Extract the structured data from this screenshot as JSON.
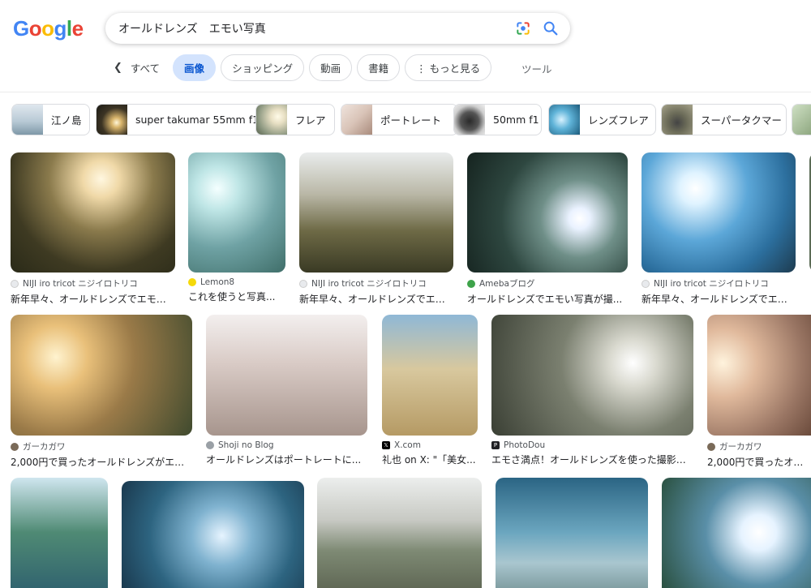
{
  "logo": {
    "letters": [
      "G",
      "o",
      "o",
      "g",
      "l",
      "e"
    ],
    "colors": [
      "#4285f4",
      "#ea4335",
      "#fbbc05",
      "#4285f4",
      "#34a853",
      "#ea4335"
    ]
  },
  "search": {
    "query": "オールドレンズ　エモい写真"
  },
  "tabs": [
    {
      "label": "すべて",
      "active": false
    },
    {
      "label": "画像",
      "active": true
    },
    {
      "label": "ショッピング",
      "active": false
    },
    {
      "label": "動画",
      "active": false
    },
    {
      "label": "書籍",
      "active": false
    },
    {
      "label": "⋮ もっと見る",
      "active": false
    }
  ],
  "tools_label": "ツール",
  "chips": [
    {
      "label": "江ノ島"
    },
    {
      "label": "super takumar 55mm f1"
    },
    {
      "label": "フレア"
    },
    {
      "label": "ポートレート"
    },
    {
      "label": "50mm f1"
    },
    {
      "label": "レンズフレア"
    },
    {
      "label": "スーパータクマー"
    }
  ],
  "results": [
    {
      "source": "NIJI iro tricot ニジイロトリコ",
      "title": "新年早々、オールドレンズでエモい..."
    },
    {
      "source": "Lemon8",
      "title": "これを使うと写真..."
    },
    {
      "source": "NIJI iro tricot ニジイロトリコ",
      "title": "新年早々、オールドレンズでエモ..."
    },
    {
      "source": "Amebaブログ",
      "title": "オールドレンズでエモい写真が撮..."
    },
    {
      "source": "NIJI iro tricot ニジイロトリコ",
      "title": "新年早々、オールドレンズでエモ..."
    },
    {
      "source": "ガーカガワ",
      "title": "2,000円で買ったオールドレンズがエモ..."
    },
    {
      "source": "Shoji no Blog",
      "title": "オールドレンズはポートレートに..."
    },
    {
      "source": "X.com",
      "title": "礼也 on X: \"「美女..."
    },
    {
      "source": "PhotoDou",
      "title": "エモさ満点！オールドレンズを使った撮影方..."
    },
    {
      "source": "ガーカガワ",
      "title": "2,000円で買ったオール..."
    }
  ],
  "colors": {
    "accent": "#0b57d0",
    "active_tab_bg": "#d3e3fd"
  }
}
